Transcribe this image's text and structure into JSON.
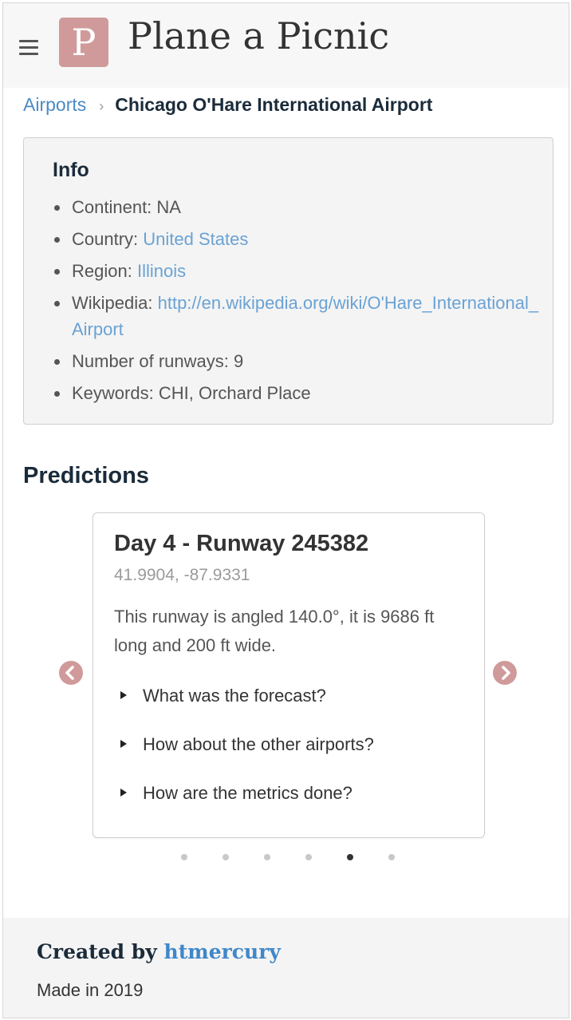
{
  "header": {
    "logo_letter": "P",
    "site_title": "Plane a Picnic"
  },
  "breadcrumb": {
    "parent": "Airports",
    "separator": "›",
    "current": "Chicago O'Hare International Airport"
  },
  "info": {
    "title": "Info",
    "continent_label": "Continent:",
    "continent_value": "NA",
    "country_label": "Country:",
    "country_value": "United States",
    "region_label": "Region:",
    "region_value": "Illinois",
    "wikipedia_label": "Wikipedia:",
    "wikipedia_value": "http://en.wikipedia.org/wiki/O'Hare_International_Airport",
    "runways_label": "Number of runways:",
    "runways_value": "9",
    "keywords_label": "Keywords:",
    "keywords_value": "CHI, Orchard Place"
  },
  "predictions": {
    "title": "Predictions",
    "card": {
      "title": "Day 4 - Runway 245382",
      "coords": "41.9904, -87.9331",
      "description": "This runway is angled 140.0°, it is 9686 ft long and 200 ft wide.",
      "questions": [
        "What was the forecast?",
        "How about the other airports?",
        "How are the metrics done?"
      ]
    },
    "dots_total": 6,
    "active_dot": 5
  },
  "footer": {
    "created_by": "Created by",
    "author": "htmercury",
    "made_in": "Made in 2019"
  },
  "colors": {
    "accent_rose": "#d09a9a",
    "link_blue": "#6aa2d4",
    "heading_navy": "#1b2b3a"
  },
  "icons": [
    "hamburger-menu-icon",
    "chevron-left-icon",
    "chevron-right-icon",
    "triangle-right-icon"
  ]
}
